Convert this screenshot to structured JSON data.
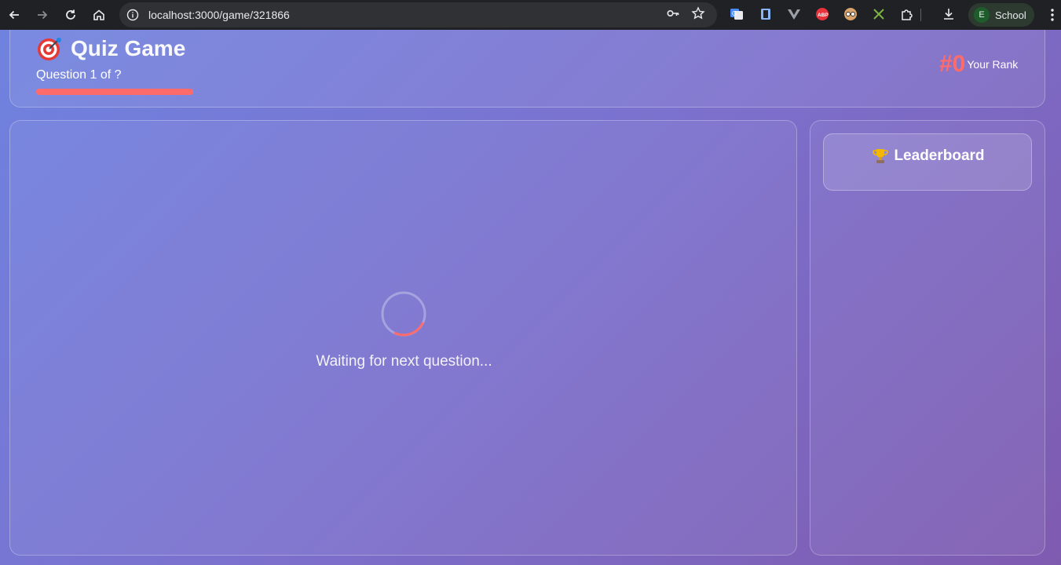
{
  "browser": {
    "url": "localhost:3000/game/321866",
    "profile_initial": "E",
    "profile_name": "School"
  },
  "header": {
    "title": "Quiz Game",
    "title_icon": "target-icon",
    "question_counter": "Question 1 of ?",
    "progress_fraction": 1.0,
    "rank_value": "#0",
    "rank_label": "Your Rank"
  },
  "main": {
    "waiting_text": "Waiting for next question..."
  },
  "leaderboard": {
    "title": "Leaderboard",
    "icon": "trophy-icon"
  },
  "colors": {
    "accent": "#ff6b6b",
    "gradient_start": "#6f82df",
    "gradient_end": "#7f5bb0"
  }
}
